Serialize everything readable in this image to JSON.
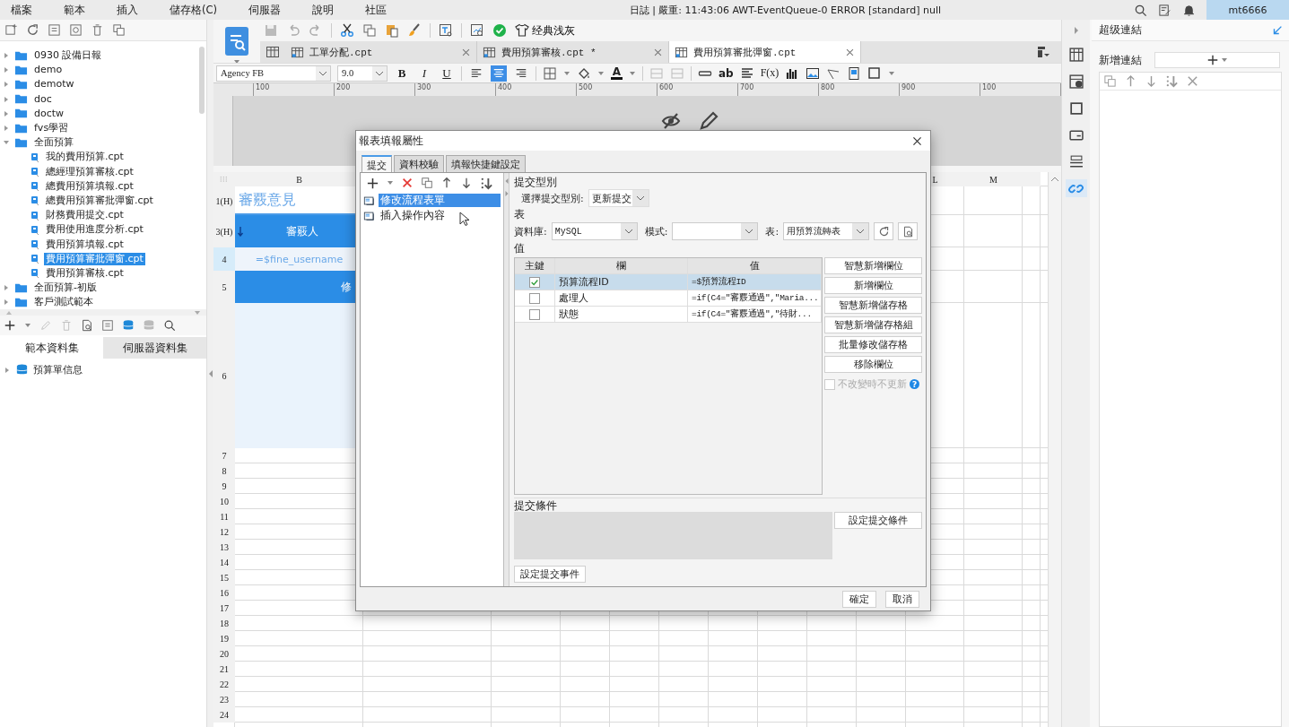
{
  "menu_bar": {
    "items": [
      "檔案",
      "範本",
      "插入",
      "儲存格(C)",
      "伺服器",
      "說明",
      "社區"
    ],
    "log": "日誌 | 嚴重: 11:43:06 AWT-EventQueue-0 ERROR [standard] null",
    "user": "mt6666"
  },
  "file_tree": [
    {
      "kind": "folder",
      "label": "0930 設備日報",
      "expanded": false,
      "selected": false
    },
    {
      "kind": "folder",
      "label": "demo",
      "expanded": false,
      "selected": false
    },
    {
      "kind": "folder",
      "label": "demotw",
      "expanded": false,
      "selected": false
    },
    {
      "kind": "folder",
      "label": "doc",
      "expanded": false,
      "selected": false
    },
    {
      "kind": "folder",
      "label": "doctw",
      "expanded": false,
      "selected": false
    },
    {
      "kind": "folder",
      "label": "fvs學習",
      "expanded": false,
      "selected": false
    },
    {
      "kind": "folder",
      "label": "全面預算",
      "expanded": true,
      "selected": false,
      "children": [
        {
          "kind": "file",
          "label": "我的費用預算.cpt",
          "selected": false
        },
        {
          "kind": "file",
          "label": "總經理預算審核.cpt",
          "selected": false
        },
        {
          "kind": "file",
          "label": "總費用預算填報.cpt",
          "selected": false
        },
        {
          "kind": "file",
          "label": "總費用預算審批彈窗.cpt",
          "selected": false
        },
        {
          "kind": "file",
          "label": "財務費用提交.cpt",
          "selected": false
        },
        {
          "kind": "file",
          "label": "費用使用進度分析.cpt",
          "selected": false
        },
        {
          "kind": "file",
          "label": "費用預算填報.cpt",
          "selected": false
        },
        {
          "kind": "file",
          "label": "費用預算審批彈窗.cpt",
          "selected": true
        },
        {
          "kind": "file",
          "label": "費用預算審核.cpt",
          "selected": false
        }
      ]
    },
    {
      "kind": "folder",
      "label": "全面預算-初版",
      "expanded": false,
      "selected": false
    },
    {
      "kind": "folder",
      "label": "客戶測試範本",
      "expanded": false,
      "selected": false
    }
  ],
  "dataset_tabs": [
    {
      "label": "範本資料集",
      "selected": true
    },
    {
      "label": "伺服器資料集",
      "selected": false
    }
  ],
  "dataset_tree": [
    {
      "label": "預算單信息",
      "expanded": false
    }
  ],
  "toolbar": {
    "theme": "经典浅灰"
  },
  "editor_tabs": [
    {
      "label": "工單分配.cpt",
      "selected": false
    },
    {
      "label": "費用預算審核.cpt *",
      "selected": false
    },
    {
      "label": "費用預算審批彈窗.cpt",
      "selected": true
    }
  ],
  "format_bar": {
    "font": "Agency FB",
    "size": "9.0",
    "style_buttons": [
      "B",
      "I",
      "U"
    ],
    "align": [
      {
        "kind": "left",
        "selected": false
      },
      {
        "kind": "center",
        "selected": true
      },
      {
        "kind": "right",
        "selected": false
      }
    ],
    "font_color": "A",
    "insert_labels": [
      "ab",
      "F(x)"
    ]
  },
  "ruler": [
    "100",
    "200",
    "300",
    "400",
    "500",
    "600",
    "700",
    "800",
    "900",
    "100"
  ],
  "sheet": {
    "columns": [
      "B",
      "L",
      "M"
    ],
    "rows": [
      {
        "label": "1(H)",
        "selected": false,
        "cell": {
          "kind": "title",
          "text": "審覈意見"
        }
      },
      {
        "label": "3(H)",
        "selected": false,
        "cell": {
          "kind": "header",
          "text": "審覈人"
        }
      },
      {
        "label": "4",
        "selected": true,
        "cell": {
          "kind": "formula",
          "text": "=$fine_username"
        }
      },
      {
        "label": "5",
        "selected": false,
        "cell": {
          "kind": "banner",
          "text": "修"
        }
      },
      {
        "label": "6",
        "selected": false,
        "cell": {
          "kind": "body"
        }
      },
      {
        "label": "7",
        "selected": false
      },
      {
        "label": "8",
        "selected": false
      },
      {
        "label": "9",
        "selected": false
      },
      {
        "label": "10",
        "selected": false
      },
      {
        "label": "11",
        "selected": false
      },
      {
        "label": "12",
        "selected": false
      },
      {
        "label": "13",
        "selected": false
      },
      {
        "label": "14",
        "selected": false
      },
      {
        "label": "15",
        "selected": false
      },
      {
        "label": "16",
        "selected": false
      },
      {
        "label": "17",
        "selected": false
      },
      {
        "label": "18",
        "selected": false
      },
      {
        "label": "19",
        "selected": false
      },
      {
        "label": "20",
        "selected": false
      },
      {
        "label": "21",
        "selected": false
      },
      {
        "label": "22",
        "selected": false
      },
      {
        "label": "23",
        "selected": false
      },
      {
        "label": "24",
        "selected": false
      }
    ]
  },
  "side_strip": [
    {
      "kind": "grid",
      "selected": false
    },
    {
      "kind": "info",
      "selected": false
    },
    {
      "kind": "frame",
      "selected": false
    },
    {
      "kind": "panel",
      "selected": false
    },
    {
      "kind": "list",
      "selected": false
    },
    {
      "kind": "link",
      "selected": true
    }
  ],
  "right_panel": {
    "title": "超级連結",
    "add_label": "新增連結"
  },
  "dialog": {
    "title": "報表填報屬性",
    "tabs": [
      {
        "label": "提交",
        "selected": true
      },
      {
        "label": "資料校驗",
        "selected": false
      },
      {
        "label": "填報快捷鍵設定",
        "selected": false
      }
    ],
    "actions": [
      {
        "label": "修改流程表單",
        "selected": true
      },
      {
        "label": "插入操作內容",
        "selected": false
      }
    ],
    "submit_type_heading": "提交型別",
    "submit_type_label": "選擇提交型別:",
    "submit_type": "更新提交",
    "table_heading": "表",
    "database_label": "資料庫:",
    "database": "MySQL",
    "schema_label": "模式:",
    "table_label": "表:",
    "table": "用預算流轉表",
    "values_heading": "值",
    "columns": [
      "主鍵",
      "欄",
      "值"
    ],
    "rows": [
      {
        "key": true,
        "selected": true,
        "field": "預算流程ID",
        "value": "=$預算流程ID"
      },
      {
        "key": false,
        "selected": false,
        "field": "處理人",
        "value": "=if(C4=\"審覈通過\",\"Maria..."
      },
      {
        "key": false,
        "selected": false,
        "field": "狀態",
        "value": "=if(C4=\"審覈通過\",\"待財..."
      }
    ],
    "side_buttons": [
      "智慧新增欄位",
      "新增欄位",
      "智慧新增儲存格",
      "智慧新增儲存格組",
      "批量修改儲存格",
      "移除欄位"
    ],
    "unchanged_option": {
      "label": "不改變時不更新",
      "checked": false,
      "disabled": true,
      "help": "?"
    },
    "condition_heading": "提交條件",
    "condition_button": "設定提交條件",
    "event_button": "設定提交事件",
    "ok": "確定",
    "cancel": "取消"
  }
}
